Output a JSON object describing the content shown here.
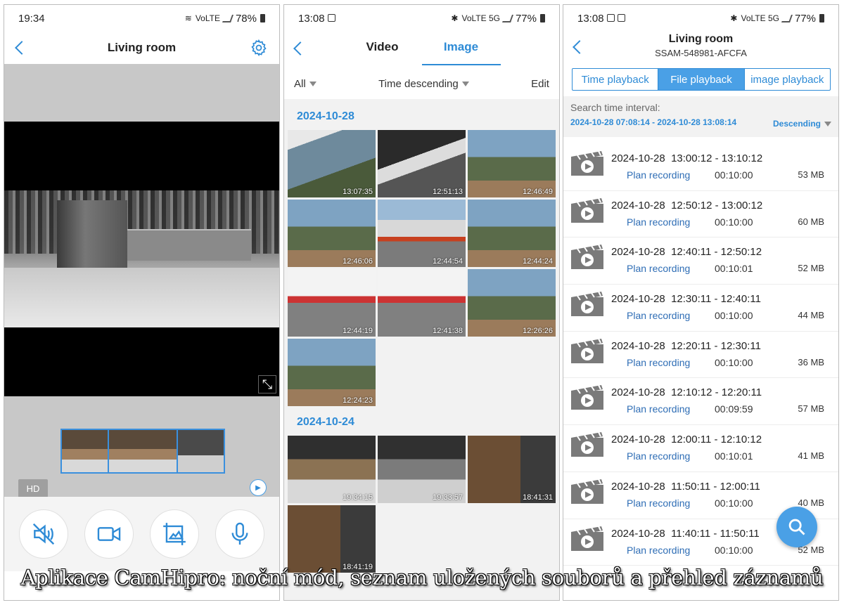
{
  "colors": {
    "accent": "#2e8bd6",
    "accent_light": "#4aa0e6",
    "gray_bg": "#c8c8c8"
  },
  "panel1": {
    "status": {
      "time": "19:34",
      "battery": "78%",
      "icons": "VoLTE"
    },
    "title": "Living room",
    "hd_label": "HD",
    "controls": [
      "speaker-icon",
      "record-video-icon",
      "snapshot-icon",
      "microphone-icon"
    ]
  },
  "panel2": {
    "status": {
      "time": "13:08",
      "battery": "77%",
      "icons": "VoLTE 5G"
    },
    "tabs": [
      "Video",
      "Image"
    ],
    "active_tab": "Image",
    "filter_all": "All",
    "filter_sort": "Time descending",
    "edit": "Edit",
    "groups": [
      {
        "date": "2024-10-28",
        "times": [
          "13:07:35",
          "12:51:13",
          "12:46:49",
          "12:46:06",
          "12:44:54",
          "12:44:24",
          "12:44:19",
          "12:41:38",
          "12:26:26",
          "12:24:23"
        ]
      },
      {
        "date": "2024-10-24",
        "times": [
          "19:34:15",
          "19:33:57",
          "18:41:31",
          "18:41:19"
        ]
      }
    ]
  },
  "panel3": {
    "status": {
      "time": "13:08",
      "battery": "77%",
      "icons": "VoLTE 5G"
    },
    "title": "Living room",
    "subtitle": "SSAM-548981-AFCFA",
    "segments": [
      "Time playback",
      "File playback",
      "image playback"
    ],
    "selected_segment": "File playback",
    "search_label": "Search time interval:",
    "interval": "2024-10-28 07:08:14 - 2024-10-28 13:08:14",
    "order": "Descending",
    "records": [
      {
        "time": "2024-10-28  13:00:12 - 13:10:12",
        "type": "Plan recording",
        "duration": "00:10:00",
        "size": "53 MB"
      },
      {
        "time": "2024-10-28  12:50:12 - 13:00:12",
        "type": "Plan recording",
        "duration": "00:10:00",
        "size": "60 MB"
      },
      {
        "time": "2024-10-28  12:40:11 - 12:50:12",
        "type": "Plan recording",
        "duration": "00:10:01",
        "size": "52 MB"
      },
      {
        "time": "2024-10-28  12:30:11 - 12:40:11",
        "type": "Plan recording",
        "duration": "00:10:00",
        "size": "44 MB"
      },
      {
        "time": "2024-10-28  12:20:11 - 12:30:11",
        "type": "Plan recording",
        "duration": "00:10:00",
        "size": "36 MB"
      },
      {
        "time": "2024-10-28  12:10:12 - 12:20:11",
        "type": "Plan recording",
        "duration": "00:09:59",
        "size": "57 MB"
      },
      {
        "time": "2024-10-28  12:00:11 - 12:10:12",
        "type": "Plan recording",
        "duration": "00:10:01",
        "size": "41 MB"
      },
      {
        "time": "2024-10-28  11:50:11 - 12:00:11",
        "type": "Plan recording",
        "duration": "00:10:00",
        "size": "40 MB"
      },
      {
        "time": "2024-10-28  11:40:11 - 11:50:11",
        "type": "Plan recording",
        "duration": "00:10:00",
        "size": "52 MB"
      }
    ]
  },
  "caption": "Aplikace CamHipro: noční mód, seznam uložených souborů a přehled záznamů"
}
